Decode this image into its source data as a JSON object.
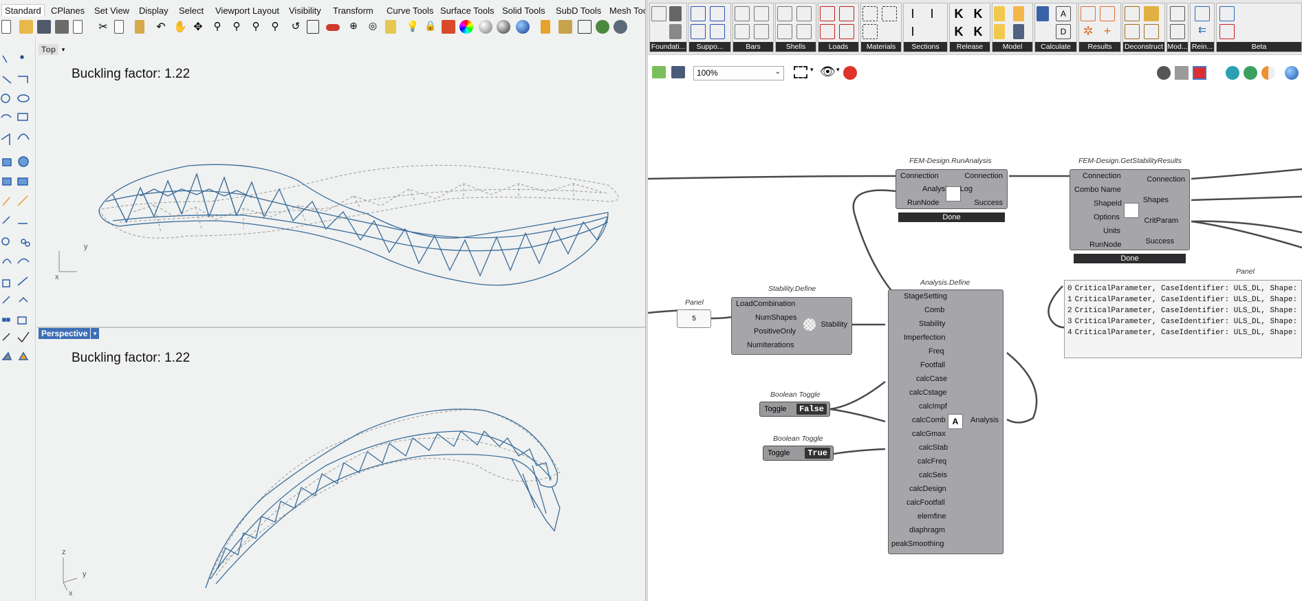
{
  "rhino": {
    "menu": [
      "Standard",
      "CPlanes",
      "Set View",
      "Display",
      "Select",
      "Viewport Layout",
      "Visibility",
      "Transform",
      "Curve Tools",
      "Surface Tools",
      "Solid Tools",
      "SubD Tools",
      "Mesh Too"
    ],
    "viewport_top": {
      "name": "Top",
      "axis_x": "x",
      "axis_y": "y",
      "overlay": "Buckling factor:  1.22"
    },
    "viewport_persp": {
      "name": "Perspective",
      "axis_x": "x",
      "axis_y": "y",
      "axis_z": "z",
      "overlay": "Buckling factor:  1.22"
    }
  },
  "gh": {
    "ribbon_groups": [
      "Foundati...",
      "Suppo...",
      "Bars",
      "Shells",
      "Loads",
      "Materials",
      "Sections",
      "Release",
      "Model",
      "Calculate",
      "Results",
      "Deconstruct",
      "Mod...",
      "Rein...",
      "Beta"
    ],
    "zoom": "100%",
    "run_analysis": {
      "title": "FEM-Design.RunAnalysis",
      "inputs": [
        "Connection",
        "Analysis",
        "RunNode"
      ],
      "outputs": [
        "Connection",
        "Log",
        "Success"
      ],
      "status": "Done"
    },
    "stability_results": {
      "title": "FEM-Design.GetStabilityResults",
      "inputs": [
        "Connection",
        "Combo Name",
        "ShapeId",
        "Options",
        "Units",
        "RunNode"
      ],
      "outputs": [
        "Connection",
        "Shapes",
        "CritParam",
        "Success"
      ],
      "status": "Done"
    },
    "panel_small": {
      "title": "Panel",
      "value": "5"
    },
    "stability_define": {
      "title": "Stability.Define",
      "inputs": [
        "LoadCombination",
        "NumShapes",
        "PositiveOnly",
        "NumIterations"
      ],
      "output": "Stability"
    },
    "analysis_define": {
      "title": "Analysis.Define",
      "inputs": [
        "StageSetting",
        "Comb",
        "Stability",
        "Imperfection",
        "Freq",
        "Footfall",
        "calcCase",
        "calcCstage",
        "calcImpf",
        "calcComb",
        "calcGmax",
        "calcStab",
        "calcFreq",
        "calcSeis",
        "calcDesign",
        "calcFootfall",
        "elemfine",
        "diaphragm",
        "peakSmoothing"
      ],
      "output": "Analysis"
    },
    "toggle1": {
      "title": "Boolean Toggle",
      "label": "Toggle",
      "value": "False"
    },
    "toggle2": {
      "title": "Boolean Toggle",
      "label": "Toggle",
      "value": "True"
    },
    "panel_big": {
      "title": "Panel",
      "rows": [
        {
          "i": "0",
          "t": "CriticalParameter, CaseIdentifier: ULS_DL, Shape:"
        },
        {
          "i": "1",
          "t": "CriticalParameter, CaseIdentifier: ULS_DL, Shape:"
        },
        {
          "i": "2",
          "t": "CriticalParameter, CaseIdentifier: ULS_DL, Shape:"
        },
        {
          "i": "3",
          "t": "CriticalParameter, CaseIdentifier: ULS_DL, Shape:"
        },
        {
          "i": "4",
          "t": "CriticalParameter, CaseIdentifier: ULS_DL, Shape:"
        }
      ]
    }
  }
}
